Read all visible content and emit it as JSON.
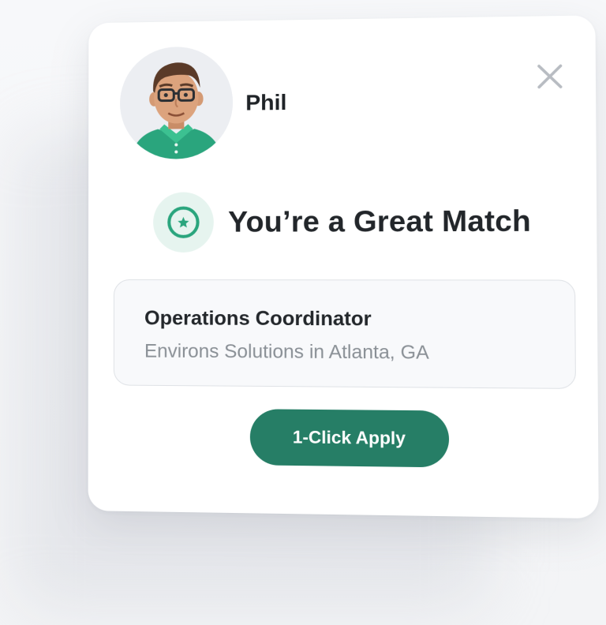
{
  "profile": {
    "name": "Phil",
    "avatar_icon": "person-avatar-icon"
  },
  "close": {
    "icon": "close-icon"
  },
  "match": {
    "icon": "star-badge-icon",
    "title": "You’re a Great Match"
  },
  "job": {
    "title": "Operations Coordinator",
    "company_location": "Environs Solutions in Atlanta, GA"
  },
  "apply": {
    "label": "1-Click Apply"
  },
  "colors": {
    "accent": "#267e66",
    "accent_light": "#e6f4ef",
    "icon_green": "#2aa57d",
    "text_dark": "#22262a",
    "text_muted": "#8a9096",
    "close_gray": "#b8bcc2"
  }
}
